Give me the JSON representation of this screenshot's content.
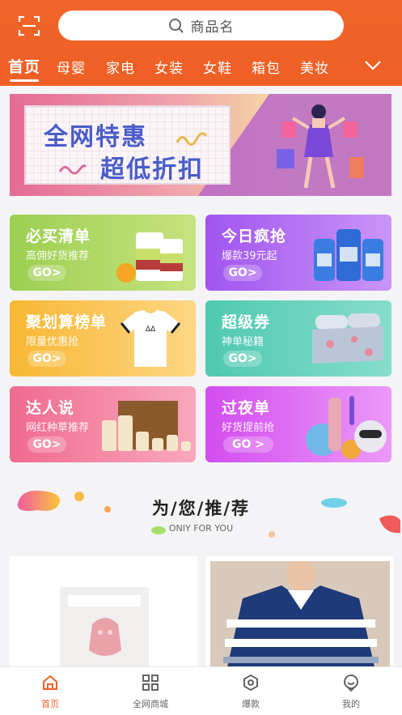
{
  "header": {
    "search_placeholder": "商品名",
    "tabs": [
      "首页",
      "母婴",
      "家电",
      "女装",
      "女鞋",
      "箱包",
      "美妆"
    ],
    "active_tab": "首页"
  },
  "banner": {
    "line1": "全网特惠",
    "line2": "超低折扣"
  },
  "cards": [
    {
      "title": "必买清单",
      "subtitle": "高佣好货推荐",
      "go": "GO>",
      "color_from": "#9ccf52",
      "color_to": "#bfe07a"
    },
    {
      "title": "今日疯抢",
      "subtitle": "爆款39元起",
      "go": "GO>",
      "color_from": "#a154f0",
      "color_to": "#c08af7"
    },
    {
      "title": "聚划算榜单",
      "subtitle": "限量优惠抢",
      "go": "GO>",
      "color_from": "#f7b733",
      "color_to": "#fcd27a"
    },
    {
      "title": "超级券",
      "subtitle": "神单秘籍",
      "go": "GO>",
      "color_from": "#4fc9b0",
      "color_to": "#7ddcc8"
    },
    {
      "title": "达人说",
      "subtitle": "网红种草推荐",
      "go": "GO>",
      "color_from": "#f06a8f",
      "color_to": "#f7a0b8"
    },
    {
      "title": "过夜单",
      "subtitle": "好货提前抢",
      "go": "GO >",
      "color_from": "#d24df0",
      "color_to": "#e890f7"
    }
  ],
  "recommend": {
    "title": "为/您/推/荐",
    "subtitle": "ONIY FOR YOU"
  },
  "bottom_nav": [
    {
      "label": "首页",
      "icon": "home-icon",
      "active": true
    },
    {
      "label": "全网商城",
      "icon": "grid-icon",
      "active": false
    },
    {
      "label": "爆款",
      "icon": "hexagon-icon",
      "active": false
    },
    {
      "label": "我的",
      "icon": "chat-user-icon",
      "active": false
    }
  ],
  "colors": {
    "brand": "#ef6029",
    "active_nav": "#ef6029"
  }
}
